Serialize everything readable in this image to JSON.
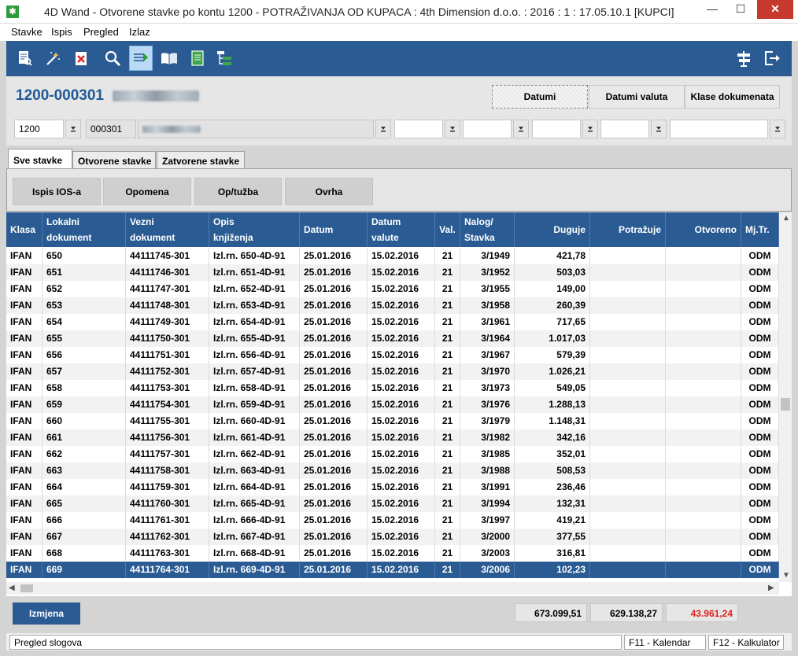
{
  "window": {
    "title": "4D Wand - Otvorene stavke po kontu 1200 - POTRAŽIVANJA OD KUPACA : 4th Dimension d.o.o. : 2016 : 1 : 17.05.10.1 [KUPCI]",
    "minimize_glyph": "—",
    "maximize_glyph": "☐",
    "close_glyph": "✕",
    "app_icon_glyph": "✱"
  },
  "menu": {
    "items": [
      "Stavke",
      "Ispis",
      "Pregled",
      "Izlaz"
    ]
  },
  "toolbar": {
    "icons": [
      "report-icon",
      "wand-icon",
      "delete-doc-icon",
      "search-icon",
      "filter-list-icon",
      "book-icon",
      "document-icon",
      "tree-icon",
      "signpost-icon",
      "exit-icon"
    ]
  },
  "header": {
    "account": "1200-000301",
    "view_buttons": [
      "Datumi",
      "Datumi valuta",
      "Klase dokumenata"
    ],
    "fields": {
      "konto": "1200",
      "partner_code": "000301"
    }
  },
  "tabs": [
    "Sve stavke",
    "Otvorene stavke",
    "Zatvorene stavke"
  ],
  "actions": [
    "Ispis IOS-a",
    "Opomena",
    "Op/tužba",
    "Ovrha"
  ],
  "table": {
    "columns": [
      {
        "l1": "Klasa",
        "l2": ""
      },
      {
        "l1": "Lokalni",
        "l2": "dokument"
      },
      {
        "l1": "Vezni",
        "l2": "dokument"
      },
      {
        "l1": "Opis",
        "l2": "knjiženja"
      },
      {
        "l1": "Datum",
        "l2": ""
      },
      {
        "l1": "Datum",
        "l2": "valute"
      },
      {
        "l1": "Val.",
        "l2": ""
      },
      {
        "l1": "Nalog/",
        "l2": "Stavka"
      },
      {
        "l1": "Duguje",
        "l2": ""
      },
      {
        "l1": "Potražuje",
        "l2": ""
      },
      {
        "l1": "Otvoreno",
        "l2": ""
      },
      {
        "l1": "Mj.Tr.",
        "l2": ""
      }
    ],
    "rows": [
      [
        "IFAN",
        "650",
        "44111745-301",
        "Izl.rn. 650-4D-91",
        "25.01.2016",
        "15.02.2016",
        "21",
        "3/1949",
        "421,78",
        "",
        "",
        "ODM"
      ],
      [
        "IFAN",
        "651",
        "44111746-301",
        "Izl.rn. 651-4D-91",
        "25.01.2016",
        "15.02.2016",
        "21",
        "3/1952",
        "503,03",
        "",
        "",
        "ODM"
      ],
      [
        "IFAN",
        "652",
        "44111747-301",
        "Izl.rn. 652-4D-91",
        "25.01.2016",
        "15.02.2016",
        "21",
        "3/1955",
        "149,00",
        "",
        "",
        "ODM"
      ],
      [
        "IFAN",
        "653",
        "44111748-301",
        "Izl.rn. 653-4D-91",
        "25.01.2016",
        "15.02.2016",
        "21",
        "3/1958",
        "260,39",
        "",
        "",
        "ODM"
      ],
      [
        "IFAN",
        "654",
        "44111749-301",
        "Izl.rn. 654-4D-91",
        "25.01.2016",
        "15.02.2016",
        "21",
        "3/1961",
        "717,65",
        "",
        "",
        "ODM"
      ],
      [
        "IFAN",
        "655",
        "44111750-301",
        "Izl.rn. 655-4D-91",
        "25.01.2016",
        "15.02.2016",
        "21",
        "3/1964",
        "1.017,03",
        "",
        "",
        "ODM"
      ],
      [
        "IFAN",
        "656",
        "44111751-301",
        "Izl.rn. 656-4D-91",
        "25.01.2016",
        "15.02.2016",
        "21",
        "3/1967",
        "579,39",
        "",
        "",
        "ODM"
      ],
      [
        "IFAN",
        "657",
        "44111752-301",
        "Izl.rn. 657-4D-91",
        "25.01.2016",
        "15.02.2016",
        "21",
        "3/1970",
        "1.026,21",
        "",
        "",
        "ODM"
      ],
      [
        "IFAN",
        "658",
        "44111753-301",
        "Izl.rn. 658-4D-91",
        "25.01.2016",
        "15.02.2016",
        "21",
        "3/1973",
        "549,05",
        "",
        "",
        "ODM"
      ],
      [
        "IFAN",
        "659",
        "44111754-301",
        "Izl.rn. 659-4D-91",
        "25.01.2016",
        "15.02.2016",
        "21",
        "3/1976",
        "1.288,13",
        "",
        "",
        "ODM"
      ],
      [
        "IFAN",
        "660",
        "44111755-301",
        "Izl.rn. 660-4D-91",
        "25.01.2016",
        "15.02.2016",
        "21",
        "3/1979",
        "1.148,31",
        "",
        "",
        "ODM"
      ],
      [
        "IFAN",
        "661",
        "44111756-301",
        "Izl.rn. 661-4D-91",
        "25.01.2016",
        "15.02.2016",
        "21",
        "3/1982",
        "342,16",
        "",
        "",
        "ODM"
      ],
      [
        "IFAN",
        "662",
        "44111757-301",
        "Izl.rn. 662-4D-91",
        "25.01.2016",
        "15.02.2016",
        "21",
        "3/1985",
        "352,01",
        "",
        "",
        "ODM"
      ],
      [
        "IFAN",
        "663",
        "44111758-301",
        "Izl.rn. 663-4D-91",
        "25.01.2016",
        "15.02.2016",
        "21",
        "3/1988",
        "508,53",
        "",
        "",
        "ODM"
      ],
      [
        "IFAN",
        "664",
        "44111759-301",
        "Izl.rn. 664-4D-91",
        "25.01.2016",
        "15.02.2016",
        "21",
        "3/1991",
        "236,46",
        "",
        "",
        "ODM"
      ],
      [
        "IFAN",
        "665",
        "44111760-301",
        "Izl.rn. 665-4D-91",
        "25.01.2016",
        "15.02.2016",
        "21",
        "3/1994",
        "132,31",
        "",
        "",
        "ODM"
      ],
      [
        "IFAN",
        "666",
        "44111761-301",
        "Izl.rn. 666-4D-91",
        "25.01.2016",
        "15.02.2016",
        "21",
        "3/1997",
        "419,21",
        "",
        "",
        "ODM"
      ],
      [
        "IFAN",
        "667",
        "44111762-301",
        "Izl.rn. 667-4D-91",
        "25.01.2016",
        "15.02.2016",
        "21",
        "3/2000",
        "377,55",
        "",
        "",
        "ODM"
      ],
      [
        "IFAN",
        "668",
        "44111763-301",
        "Izl.rn. 668-4D-91",
        "25.01.2016",
        "15.02.2016",
        "21",
        "3/2003",
        "316,81",
        "",
        "",
        "ODM"
      ],
      [
        "IFAN",
        "669",
        "44111764-301",
        "Izl.rn. 669-4D-91",
        "25.01.2016",
        "15.02.2016",
        "21",
        "3/2006",
        "102,23",
        "",
        "",
        "ODM"
      ]
    ],
    "selected_row": 19
  },
  "footer": {
    "edit_button": "Izmjena",
    "totals": {
      "duguje": "673.099,51",
      "potrazuje": "629.138,27",
      "otvoreno": "43.961,24"
    },
    "otvoreno_color": "#e0201c"
  },
  "status": {
    "left": "Pregled slogova",
    "f11": "F11 - Kalendar",
    "f12": "F12 - Kalkulator"
  },
  "colors": {
    "accent": "#2a5b93",
    "title_blue": "#1f5a94"
  }
}
